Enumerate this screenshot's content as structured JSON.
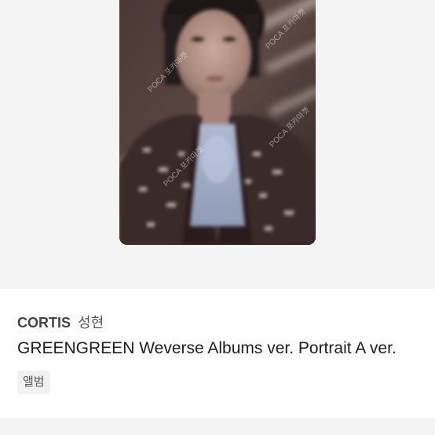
{
  "product": {
    "artist": "CORTIS",
    "member": "성현",
    "title": "GREENGREEN Weverse Albums ver. Portrait A ver.",
    "tag": "앨범",
    "watermark": "POCA 포카마켓"
  },
  "colors": {
    "image_background": "#f4f4f4",
    "tag_background": "#f1f1f1",
    "title_text": "#1e1e1e",
    "artist_text": "#444444"
  }
}
